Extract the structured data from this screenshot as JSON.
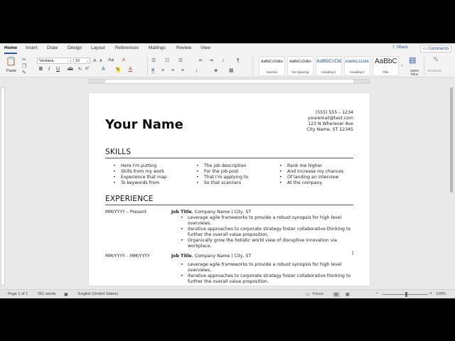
{
  "ribbon_tabs": [
    "Home",
    "Insert",
    "Draw",
    "Design",
    "Layout",
    "References",
    "Mailings",
    "Review",
    "View"
  ],
  "share_label": "Share",
  "comments_label": "Comments",
  "paste_label": "Paste",
  "font_name": "Verdana",
  "font_size": "10",
  "styles": [
    {
      "preview": "AaBbCcDdEe",
      "name": "Normal"
    },
    {
      "preview": "AaBbCcDdEe",
      "name": "No Spacing"
    },
    {
      "preview": "AaBbCcDd",
      "name": "Heading 1"
    },
    {
      "preview": "AaBbCcDdE",
      "name": "Heading 2"
    },
    {
      "preview": "AaBbC",
      "name": "Title"
    }
  ],
  "styles_pane_label": "Styles Pane",
  "sensitivity_label": "Sensitivity",
  "document": {
    "name": "Your Name",
    "contact": [
      "(555) 555 – 1234",
      "youremail@test.com",
      "123 N Wherever Ave",
      "City Name, ST 12345"
    ],
    "skills_heading": "SKILLS",
    "skills": [
      [
        "Here I'm putting",
        "Skills from my work",
        "Experience that map",
        "To keywords from"
      ],
      [
        "The job description",
        "For the job post",
        "That I'm applying to",
        "So that scanners"
      ],
      [
        "Rank me higher",
        "And increase my chances",
        "Of landing an interview",
        "At the company"
      ]
    ],
    "experience_heading": "EXPERIENCE",
    "jobs": [
      {
        "dates": "MM/YYYY – Present",
        "title": "Job Title",
        "company": ", Company Name | City, ST",
        "bullets": [
          "Leverage agile frameworks to provide a robust synopsis for high level overviews.",
          "Iterative approaches to corporate strategy foster collaborative thinking to further the overall value proposition.",
          "Organically grow the holistic world view of disruptive innovation via workplace."
        ]
      },
      {
        "dates": "MM/YYYY – MM/YYYY",
        "title": "Job Title",
        "company": ", Company Name | City, ST",
        "bullets": [
          "Leverage agile frameworks to provide a robust synopsis for high level overviews.",
          "Iterative approaches to corporate strategy foster collaborative thinking to further the overall value proposition."
        ]
      }
    ]
  },
  "status": {
    "page": "Page 1 of 1",
    "words": "251 words",
    "language": "English (United States)",
    "focus": "Focus",
    "zoom": "129%"
  },
  "colors": {
    "accent": "#2b5797",
    "page": "#ffffff",
    "workspace": "#e9e9e9"
  }
}
